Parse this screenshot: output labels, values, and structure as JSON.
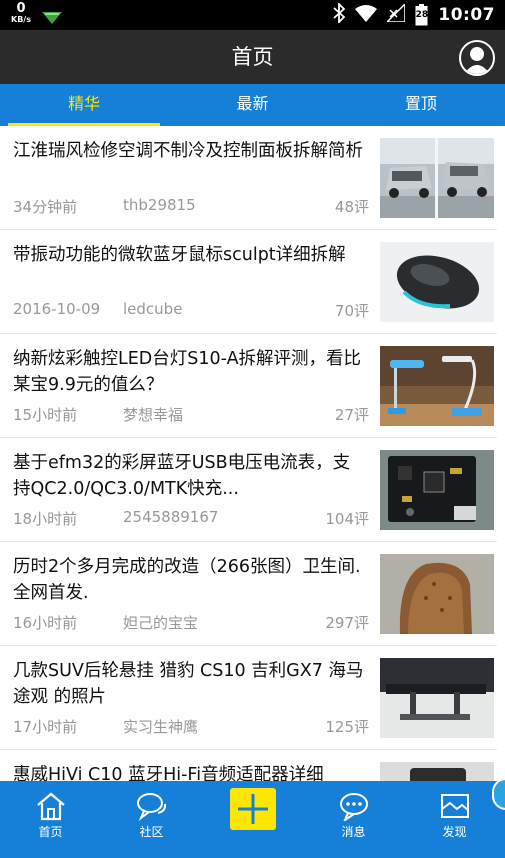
{
  "status_bar": {
    "net_speed": "0",
    "net_unit": "KB/s",
    "battery_level": "28",
    "time": "10:07"
  },
  "header": {
    "title": "首页"
  },
  "tabs": [
    {
      "label": "精华",
      "active": true
    },
    {
      "label": "最新",
      "active": false
    },
    {
      "label": "置顶",
      "active": false
    }
  ],
  "feed": [
    {
      "title": "江淮瑞风检修空调不制冷及控制面板拆解简析",
      "time": "34分钟前",
      "author": "thb29815",
      "count": "48评",
      "thumb": "car-icon"
    },
    {
      "title": "带振动功能的微软蓝牙鼠标sculpt详细拆解",
      "time": "2016-10-09",
      "author": "ledcube",
      "count": "70评",
      "thumb": "mouse-icon"
    },
    {
      "title": "纳新炫彩触控LED台灯S10-A拆解评测，看比某宝9.9元的值么？",
      "time": "15小时前",
      "author": "梦想幸福",
      "count": "27评",
      "thumb": "lamp-icon"
    },
    {
      "title": "基于efm32的彩屏蓝牙USB电压电流表，支持QC2.0/QC3.0/MTK快充...",
      "time": "18小时前",
      "author": "2545889167",
      "count": "104评",
      "thumb": "circuit-board-icon"
    },
    {
      "title": "历时2个多月完成的改造（266张图）卫生间.全网首发.",
      "time": "16小时前",
      "author": "妲己的宝宝",
      "count": "297评",
      "thumb": "pipe-icon"
    },
    {
      "title": "几款SUV后轮悬挂 猎豹 CS10 吉利GX7 海马 途观 的照片",
      "time": "17小时前",
      "author": "实习生神鹰",
      "count": "125评",
      "thumb": "suspension-icon"
    },
    {
      "title": "惠威HiVi C10 蓝牙Hi-Fi音频适配器详细",
      "time": "",
      "author": "",
      "count": "",
      "thumb": "device-icon"
    }
  ],
  "bottom_nav": [
    {
      "label": "首页",
      "icon": "home-icon",
      "active": true
    },
    {
      "label": "社区",
      "icon": "chat-bubbles-icon",
      "active": false
    },
    {
      "label": "",
      "icon": "plus-icon",
      "active": false
    },
    {
      "label": "消息",
      "icon": "message-icon",
      "active": false
    },
    {
      "label": "发现",
      "icon": "discover-icon",
      "active": false
    }
  ],
  "colors": {
    "accent_blue": "#1680d8",
    "active_yellow": "#ffe600",
    "title_bar": "#2b2b2b",
    "status_bar": "#000000"
  }
}
